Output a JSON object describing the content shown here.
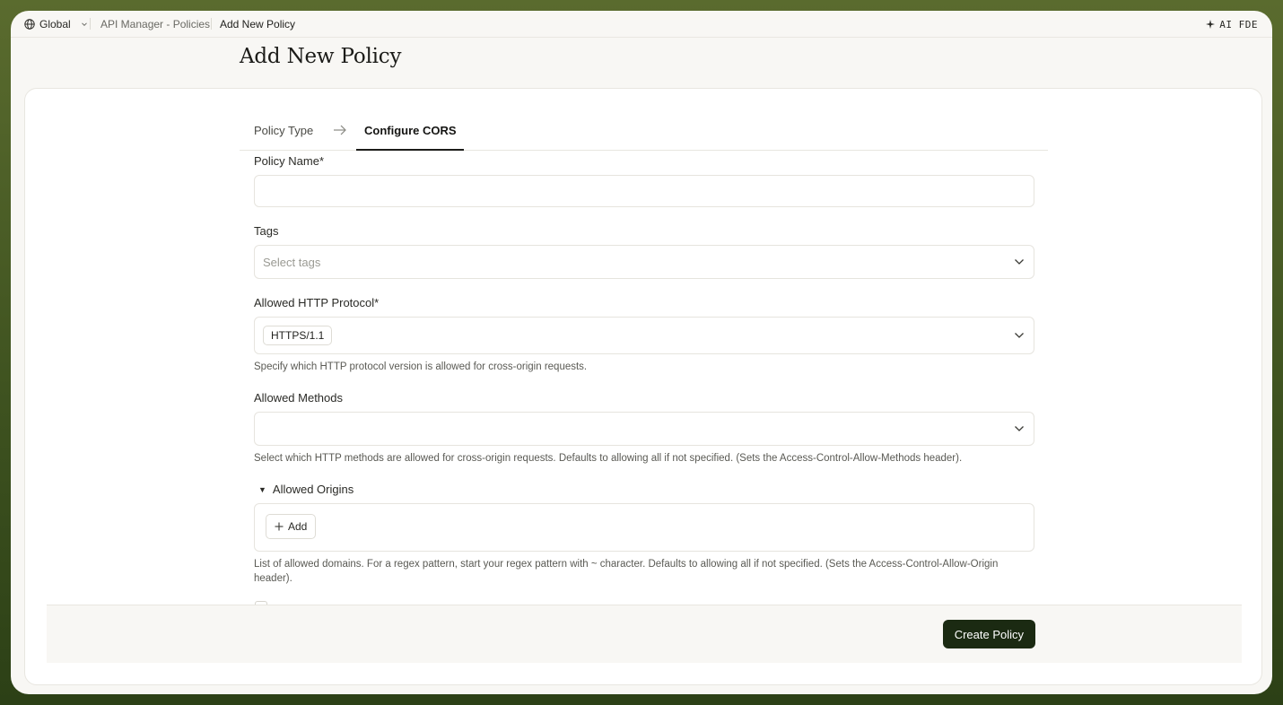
{
  "breadcrumb": {
    "scope": "Global",
    "section": "API Manager - Policies",
    "current": "Add New Policy"
  },
  "assistant": {
    "label": "AI FDE"
  },
  "page": {
    "title": "Add New Policy"
  },
  "stepper": {
    "steps": [
      {
        "label": "Policy Type",
        "active": false
      },
      {
        "label": "Configure CORS",
        "active": true
      }
    ]
  },
  "form": {
    "policy_name": {
      "label": "Policy Name*",
      "value": ""
    },
    "tags": {
      "label": "Tags",
      "placeholder": "Select tags"
    },
    "protocol": {
      "label": "Allowed HTTP Protocol*",
      "selected": "HTTPS/1.1",
      "help": "Specify which HTTP protocol version is allowed for cross-origin requests."
    },
    "methods": {
      "label": "Allowed Methods",
      "help": "Select which HTTP methods are allowed for cross-origin requests. Defaults to allowing all if not specified. (Sets the Access-Control-Allow-Methods header)."
    },
    "origins": {
      "label": "Allowed Origins",
      "add_label": "Add",
      "help": "List of allowed domains. For a regex pattern, start your regex pattern with ~ character. Defaults to allowing all if not specified. (Sets the Access-Control-Allow-Origin header)."
    }
  },
  "footer": {
    "create_label": "Create Policy"
  },
  "colors": {
    "primary_button": "#1b2a12",
    "background_frame": "#4a5d26",
    "surface": "#ffffff"
  }
}
